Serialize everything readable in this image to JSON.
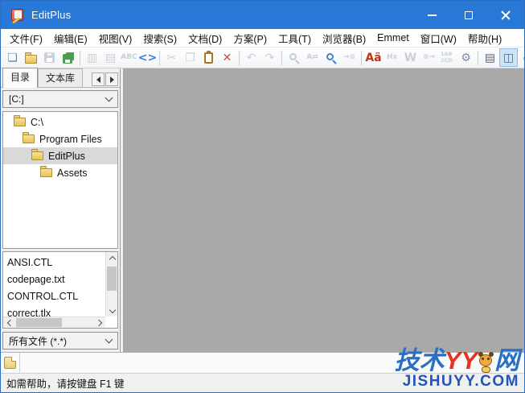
{
  "window": {
    "title": "EditPlus"
  },
  "titlebar": {
    "controls": [
      "minimize-button",
      "maximize-button",
      "close-button"
    ]
  },
  "menubar": {
    "items": [
      "文件(F)",
      "编辑(E)",
      "视图(V)",
      "搜索(S)",
      "文档(D)",
      "方案(P)",
      "工具(T)",
      "浏览器(B)",
      "Emmet",
      "窗口(W)",
      "帮助(H)"
    ]
  },
  "toolbar": {
    "groups": [
      {
        "items": [
          {
            "name": "new-document-icon",
            "glyph": "❏",
            "color": "#6b87a8",
            "enabled": true
          },
          {
            "name": "open-folder-icon",
            "shape": "folder",
            "enabled": true
          },
          {
            "name": "save-icon",
            "shape": "floppy",
            "color": "#ccd2dc",
            "enabled": false
          },
          {
            "name": "save-all-icon",
            "shape": "floppy2",
            "color": "#4aa04a",
            "enabled": true
          }
        ]
      },
      {
        "items": [
          {
            "name": "print-preview-icon",
            "glyph": "▥",
            "enabled": false
          },
          {
            "name": "print-icon",
            "glyph": "▤",
            "enabled": false
          },
          {
            "name": "spell-check-icon",
            "glyph": "ABC",
            "small": true,
            "enabled": false
          },
          {
            "name": "html-tags-icon",
            "glyph": "<>",
            "color": "#3f7fd6",
            "bold": true,
            "enabled": true
          }
        ]
      },
      {
        "items": [
          {
            "name": "cut-icon",
            "glyph": "✂",
            "enabled": false
          },
          {
            "name": "copy-icon",
            "glyph": "❐",
            "enabled": false
          },
          {
            "name": "paste-icon",
            "shape": "clipboard",
            "color": "#a5752d",
            "enabled": true
          },
          {
            "name": "delete-icon",
            "glyph": "✕",
            "color": "#d24444",
            "bold": true,
            "enabled": true
          }
        ]
      },
      {
        "items": [
          {
            "name": "undo-icon",
            "glyph": "↶",
            "enabled": false
          },
          {
            "name": "redo-icon",
            "glyph": "↷",
            "enabled": false
          }
        ]
      },
      {
        "items": [
          {
            "name": "find-icon",
            "shape": "mag",
            "color": "#c3cbd9",
            "enabled": false
          },
          {
            "name": "replace-icon",
            "glyph": "A⇄",
            "small": true,
            "enabled": false
          },
          {
            "name": "find-in-files-icon",
            "shape": "mag",
            "color": "#4a7fc0",
            "enabled": true
          },
          {
            "name": "goto-line-icon",
            "glyph": "→≡",
            "small": true,
            "enabled": false
          }
        ]
      },
      {
        "items": [
          {
            "name": "text-case-icon",
            "glyph": "Aä",
            "color": "#c23418",
            "bold": true,
            "enabled": true
          },
          {
            "name": "hex-view-icon",
            "glyph": "Hx",
            "small": true,
            "enabled": false
          },
          {
            "name": "word-wrap-icon",
            "glyph": "W",
            "bold": true,
            "enabled": false
          },
          {
            "name": "indent-icon",
            "glyph": "≡→",
            "small": true,
            "enabled": false
          },
          {
            "name": "sort-icon",
            "glyph": "1AB 2CD",
            "tiny": true,
            "enabled": false
          },
          {
            "name": "preferences-icon",
            "glyph": "⚙",
            "color": "#7e8ea4",
            "enabled": true
          }
        ]
      },
      {
        "items": [
          {
            "name": "document-list-icon",
            "glyph": "▤",
            "color": "#48689a",
            "enabled": true
          },
          {
            "name": "directory-window-icon",
            "glyph": "◫",
            "color": "#3a6ea5",
            "enabled": true,
            "active": true
          },
          {
            "name": "user-tool-icon",
            "glyph": "✐",
            "color": "#7e8ea4",
            "enabled": true
          }
        ]
      }
    ]
  },
  "sidebar": {
    "tabs": [
      {
        "label": "目录",
        "active": true
      },
      {
        "label": "文本库",
        "active": false
      }
    ],
    "drive_select": {
      "value": "[C:]"
    },
    "tree": [
      {
        "label": "C:\\",
        "indent": 0,
        "selected": false
      },
      {
        "label": "Program Files",
        "indent": 1,
        "selected": false
      },
      {
        "label": "EditPlus",
        "indent": 2,
        "selected": true
      },
      {
        "label": "Assets",
        "indent": 3,
        "selected": false
      }
    ],
    "files": [
      "ANSI.CTL",
      "codepage.txt",
      "CONTROL.CTL",
      "correct.tlx"
    ],
    "filter_select": {
      "value": "所有文件 (*.*)"
    }
  },
  "statusbar": {
    "text": "如需帮助，请按键盘 F1 键"
  },
  "watermark": {
    "part1": "技术",
    "part2": "YY",
    "part3": "网",
    "line2": "JISHUYY.COM",
    "colors": {
      "blue": "#2b6fc2",
      "red": "#e53322",
      "line2": "#2255bb"
    }
  }
}
